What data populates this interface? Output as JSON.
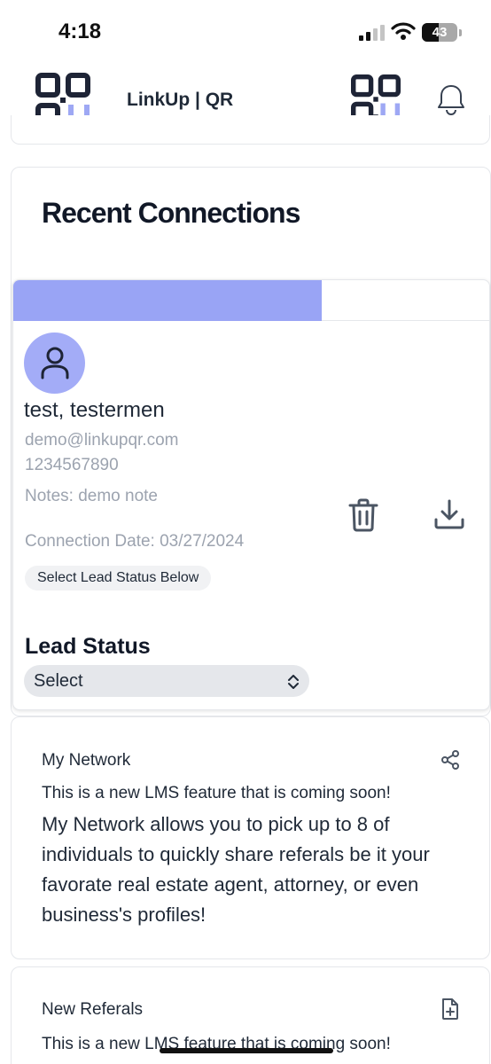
{
  "status_bar": {
    "time": "4:18",
    "battery": "43"
  },
  "header": {
    "title": "LinkUp | QR"
  },
  "recent": {
    "title": "Recent Connections",
    "progress_fraction": 0.645,
    "connection": {
      "name": "test, testermen",
      "email": "demo@linkupqr.com",
      "phone": "1234567890",
      "notes": "Notes: demo note",
      "date": "Connection Date: 03/27/2024",
      "status_pill": "Select Lead Status Below"
    },
    "lead_status": {
      "label": "Lead Status",
      "selected": "Select"
    }
  },
  "network": {
    "title": "My Network",
    "coming_soon": "This is a new LMS feature that is coming soon!",
    "description": "My Network allows you to pick up to 8 of individuals to quickly share referals be it your favorate real estate agent, attorney, or even business's profiles!"
  },
  "referals": {
    "title": "New Referals",
    "coming_soon": "This is a new LMS feature that is coming soon!"
  },
  "colors": {
    "accent": "#99a4f5",
    "avatar": "#a3acf7",
    "navy": "#1e2436"
  },
  "icons": [
    "qr-logo-icon",
    "bell-icon",
    "user-icon",
    "trash-icon",
    "download-icon",
    "chevron-updown-icon",
    "share-icon",
    "file-plus-icon"
  ]
}
